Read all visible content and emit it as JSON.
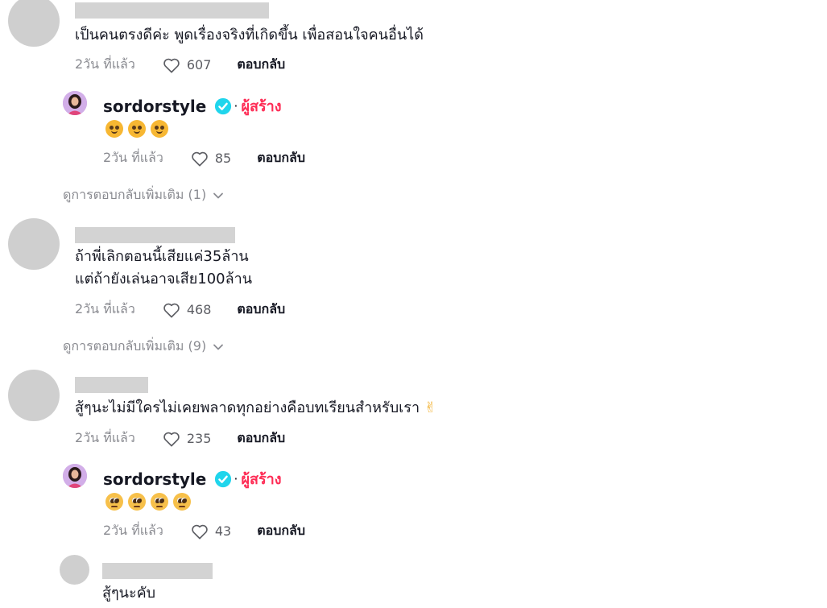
{
  "comments": [
    {
      "text_lines": [
        "เป็นคนตรงดีค่ะ พูดเรื่องจริงที่เกิดขึ้น เพื่อสอนใจคนอื่นได้"
      ],
      "time": "2วัน ที่แล้ว",
      "likes": "607",
      "reply_label": "ตอบกลับ",
      "creator_reply": {
        "username": "sordorstyle",
        "role_label": "ผู้สร้าง",
        "emojis": [
          "hugging-face",
          "hugging-face",
          "hugging-face"
        ],
        "time": "2วัน ที่แล้ว",
        "likes": "85",
        "reply_label": "ตอบกลับ"
      },
      "view_more_label": "ดูการตอบกลับเพิ่มเติม (1)"
    },
    {
      "text_lines": [
        "ถ้าพี่เลิกตอนนี้เสียแค่35ล้าน",
        "แต่ถ้ายังเล่นอาจเสีย100ล้าน"
      ],
      "time": "2วัน ที่แล้ว",
      "likes": "468",
      "reply_label": "ตอบกลับ",
      "view_more_label": "ดูการตอบกลับเพิ่มเติม (9)"
    },
    {
      "text_lines": [
        "สู้ๆนะไม่มีใครไม่เคยพลาดทุกอย่างคือบทเรียนสำหรับเรา"
      ],
      "trailing_emoji": "✌",
      "time": "2วัน ที่แล้ว",
      "likes": "235",
      "reply_label": "ตอบกลับ",
      "creator_reply": {
        "username": "sordorstyle",
        "role_label": "ผู้สร้าง",
        "emojis": [
          "pleading-face",
          "pleading-face",
          "pleading-face",
          "pleading-face"
        ],
        "time": "2วัน ที่แล้ว",
        "likes": "43",
        "reply_label": "ตอบกลับ"
      },
      "nested_reply": {
        "text": "สู้ๆนะคับ"
      }
    }
  ],
  "colors": {
    "creator_label": "#fe2c55",
    "verified_badge": "#20d5ec",
    "placeholder": "#cfcfcf"
  }
}
